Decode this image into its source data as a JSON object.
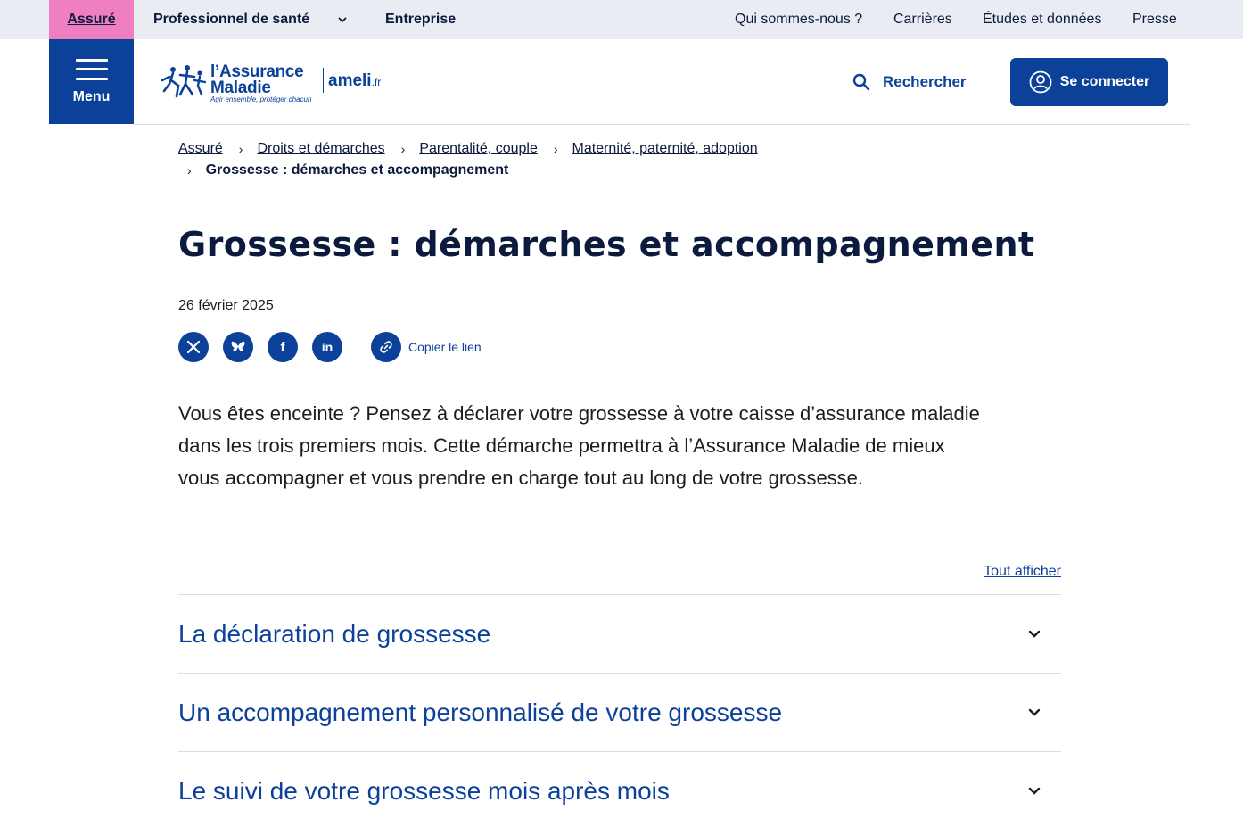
{
  "audience": {
    "assure": "Assuré",
    "pro": "Professionnel de santé",
    "entreprise": "Entreprise"
  },
  "top_links": [
    "Qui sommes-nous ?",
    "Carrières",
    "Études et données",
    "Presse"
  ],
  "header": {
    "menu_label": "Menu",
    "logo_line1": "l’Assurance",
    "logo_line2": "Maladie",
    "logo_tagline": "Agir ensemble, protéger chacun",
    "logo_ameli": "ameli",
    "logo_ameli_suffix": ".fr",
    "search_label": "Rechercher",
    "login_label": "Se connecter"
  },
  "breadcrumb": {
    "items": [
      "Assuré",
      "Droits et démarches",
      "Parentalité, couple",
      "Maternité, paternité, adoption"
    ],
    "current": "Grossesse : démarches et accompagnement"
  },
  "article": {
    "title": "Grossesse : démarches et accompagnement",
    "date": "26 février 2025",
    "copy_link": "Copier le lien",
    "intro_line1": "Vous êtes enceinte ? Pensez à déclarer votre grossesse à votre caisse d’assurance maladie",
    "intro_line2": "dans les trois premiers mois. Cette démarche permettra à l’Assurance Maladie de mieux",
    "intro_line3": "vous accompagner et vous prendre en charge tout au long de votre grossesse.",
    "show_all": "Tout afficher",
    "sections": [
      "La déclaration de grossesse",
      "Un accompagnement personnalisé de votre grossesse",
      "Le suivi de votre grossesse mois après mois"
    ]
  },
  "colors": {
    "brand_blue": "#0c419a",
    "audience_pink": "#f07fc1",
    "topbar_bg": "#e9edf3",
    "title_navy": "#0c1a3d"
  }
}
